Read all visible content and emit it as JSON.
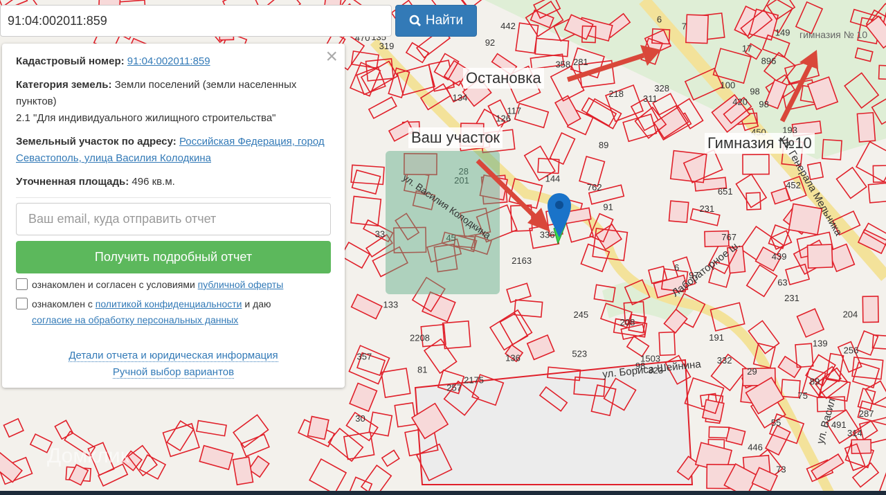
{
  "search": {
    "value": "91:04:002011:859",
    "button_label": "Найти",
    "icon": "search-icon"
  },
  "panel": {
    "close_label": "×",
    "cadastral_label": "Кадастровый номер:",
    "cadastral_value": "91:04:002011:859",
    "category_label": "Категория земель:",
    "category_value": "Земли поселений (земли населенных пунктов)",
    "usage": "2.1 \"Для индивидуального жилищного строительства\"",
    "address_label": "Земельный участок по адресу:",
    "address_value": "Российская Федерация, город Севастополь, улица Василия Колодкина",
    "area_label": "Уточненная площадь:",
    "area_value": "496 кв.м.",
    "email_placeholder": "Ваш email, куда отправить отчет",
    "submit_label": "Получить подробный отчет",
    "consent1_text": "ознакомлен и согласен с условиями ",
    "consent1_link": "публичной оферты",
    "consent2_text": "ознакомлен с ",
    "consent2_link": "политикой конфиденциальности",
    "consent2_mid": " и даю ",
    "consent2_link2": "согласие на обработку персональных данных",
    "details_link": "Детали отчета и юридическая информация",
    "manual_link": "Ручной выбор вариантов"
  },
  "map": {
    "annotations": {
      "stop": "Остановка",
      "your_plot": "Ваш участок",
      "gymnasium": "Гимназия №10"
    },
    "poi": {
      "gymnasium_label": "гимназия № 10"
    },
    "streets": {
      "sheinina": "ул. Бориса Шейнина",
      "laboratornoe": "Лабораторное ш.",
      "kolodkina": "ул. Василия Колодкина",
      "melnika": "ул. Генерала Мельника",
      "vasiliya": "ул. Васил"
    },
    "parcel_numbers": [
      "81",
      "149",
      "98",
      "491",
      "45",
      "245",
      "136",
      "446",
      "281",
      "470",
      "92",
      "2175",
      "767",
      "2163",
      "762",
      "2208",
      "6",
      "439",
      "452",
      "98",
      "314",
      "328",
      "208",
      "311",
      "357",
      "218",
      "442",
      "29",
      "144",
      "896",
      "55",
      "17",
      "287",
      "91",
      "231",
      "450",
      "133",
      "651",
      "323",
      "134",
      "135",
      "319",
      "1503",
      "89",
      "75",
      "73",
      "332",
      "191",
      "97",
      "358",
      "201",
      "100",
      "238",
      "33",
      "231",
      "98",
      "139",
      "106",
      "193",
      "523",
      "204",
      "30",
      "117",
      "256",
      "257",
      "63",
      "336",
      "420",
      "126",
      "89",
      "7",
      "6",
      "28"
    ],
    "watermark": "Домклик",
    "colors": {
      "parcel": "#e0202a",
      "road": "#f5e6a0",
      "green": "#d6e8c8",
      "arrow": "#d9473a",
      "pin": "#1a73c9",
      "selected": "#3cd54a"
    }
  }
}
